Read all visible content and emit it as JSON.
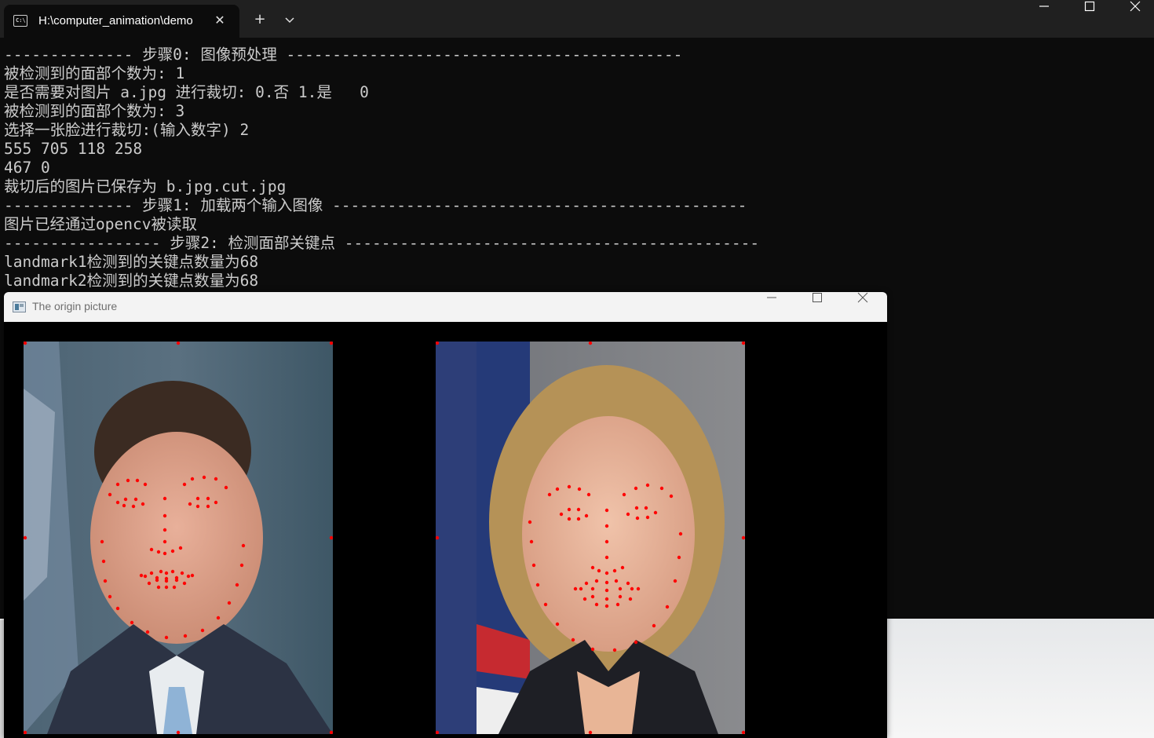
{
  "terminal": {
    "tab_title": "H:\\computer_animation\\demo",
    "tab_icon": "console-icon",
    "new_tab_label": "+",
    "dropdown_label": "⌄",
    "minimize_label": "—",
    "maximize_label": "☐",
    "close_label": "✕",
    "tab_close_label": "✕",
    "lines": [
      "-------------- 步骤0: 图像预处理 -------------------------------------------",
      "被检测到的面部个数为: 1",
      "是否需要对图片 a.jpg 进行裁切: 0.否 1.是   0",
      "被检测到的面部个数为: 3",
      "选择一张脸进行裁切:(输入数字) 2",
      "555 705 118 258",
      "467 0",
      "裁切后的图片已保存为 b.jpg.cut.jpg",
      "-------------- 步骤1: 加载两个输入图像 ---------------------------------------------",
      "图片已经通过opencv被读取",
      "----------------- 步骤2: 检测面部关键点 ---------------------------------------------",
      "landmark1检测到的关键点数量为68",
      "landmark2检测到的关键点数量为68"
    ]
  },
  "image_window": {
    "title": "The origin picture",
    "minimize_label": "—",
    "maximize_label": "☐",
    "close_label": "✕",
    "landmark_color": "#ff0000",
    "images": [
      "face-photo-1",
      "face-photo-2"
    ]
  }
}
